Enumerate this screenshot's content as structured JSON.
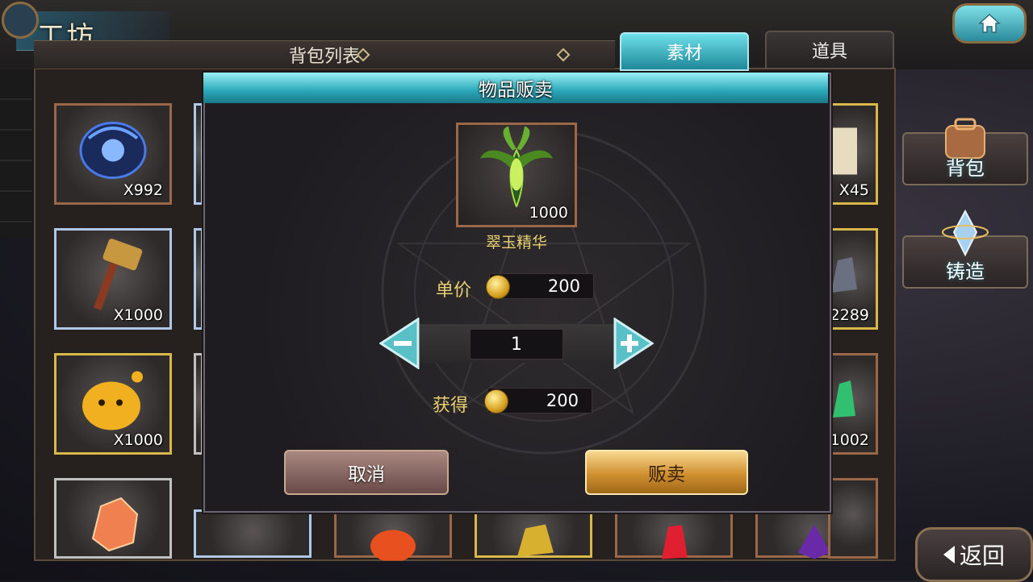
{
  "header": {
    "title": "工坊"
  },
  "inventory": {
    "list_title": "背包列表",
    "tabs": [
      {
        "label": "素材",
        "active": true
      },
      {
        "label": "道具",
        "active": false
      }
    ],
    "slots": [
      {
        "count": "X992",
        "frame": "bronze",
        "icon": "blue-orb-icon"
      },
      {
        "count": "X1000",
        "frame": "blue",
        "icon": "hammer-icon"
      },
      {
        "count": "X1000",
        "frame": "gold",
        "icon": "yellow-slime-icon"
      },
      {
        "count": "",
        "frame": "silver",
        "icon": "orange-crystal-icon"
      },
      {
        "count": "X45",
        "frame": "gold",
        "icon": "scroll-icon"
      },
      {
        "count": "2289",
        "frame": "gold",
        "icon": "dark-crystal-icon"
      },
      {
        "count": "1002",
        "frame": "bronze",
        "icon": "green-crystal-icon"
      },
      {
        "count": "",
        "frame": "bronze",
        "icon": "purple-crystal-icon"
      }
    ]
  },
  "side_buttons": [
    {
      "label": "背包",
      "icon": "backpack-icon"
    },
    {
      "label": "铸造",
      "icon": "forge-icon"
    }
  ],
  "back_button": {
    "label": "返回"
  },
  "dialog": {
    "title": "物品贩卖",
    "item": {
      "name": "翠玉精华",
      "count": "1000",
      "icon": "jade-essence-icon"
    },
    "unit_price": {
      "label": "单价",
      "value": "200"
    },
    "quantity": {
      "value": "1"
    },
    "earn": {
      "label": "获得",
      "value": "200"
    },
    "cancel_label": "取消",
    "sell_label": "贩卖"
  },
  "colors": {
    "accent_cyan": "#2aa8b8",
    "gold": "#d09030",
    "label_yellow": "#e8d070"
  }
}
